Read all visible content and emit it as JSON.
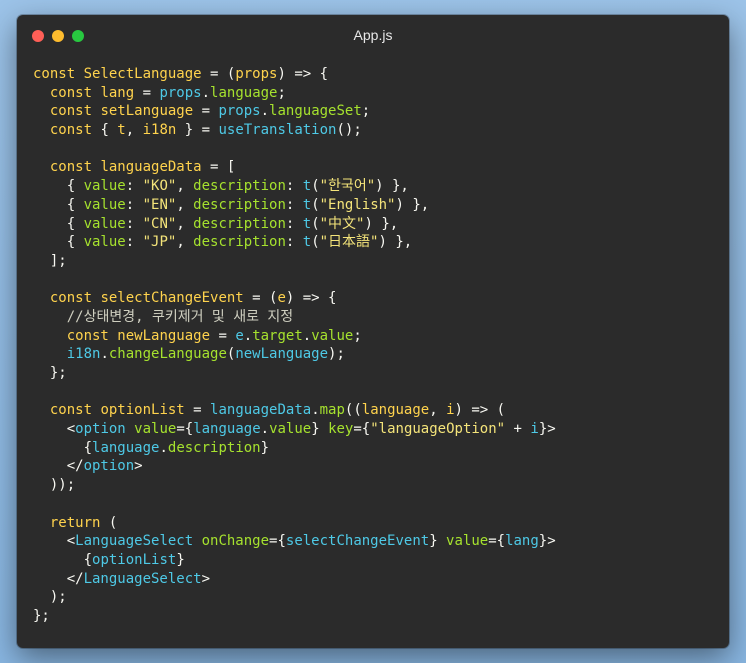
{
  "window": {
    "title": "App.js"
  },
  "colors": {
    "background": "#8fbbe3",
    "editor": "#2b2b2b",
    "keyword": "#ffd34d",
    "identifier": "#4ec9e6",
    "property": "#a6e22e",
    "string": "#f4e47a"
  },
  "code_lines": [
    [
      [
        "kw",
        "const "
      ],
      [
        "name",
        "SelectLanguage"
      ],
      [
        "op",
        " = ("
      ],
      [
        "name",
        "props"
      ],
      [
        "op",
        ") => {"
      ]
    ],
    [
      [
        "p",
        "  "
      ],
      [
        "kw",
        "const "
      ],
      [
        "name",
        "lang"
      ],
      [
        "op",
        " = "
      ],
      [
        "cyan",
        "props"
      ],
      [
        "op",
        "."
      ],
      [
        "green",
        "language"
      ],
      [
        "op",
        ";"
      ]
    ],
    [
      [
        "p",
        "  "
      ],
      [
        "kw",
        "const "
      ],
      [
        "name",
        "setLanguage"
      ],
      [
        "op",
        " = "
      ],
      [
        "cyan",
        "props"
      ],
      [
        "op",
        "."
      ],
      [
        "green",
        "languageSet"
      ],
      [
        "op",
        ";"
      ]
    ],
    [
      [
        "p",
        "  "
      ],
      [
        "kw",
        "const "
      ],
      [
        "op",
        "{ "
      ],
      [
        "name",
        "t"
      ],
      [
        "op",
        ", "
      ],
      [
        "name",
        "i18n"
      ],
      [
        "op",
        " } = "
      ],
      [
        "cyan",
        "useTranslation"
      ],
      [
        "op",
        "();"
      ]
    ],
    [],
    [
      [
        "p",
        "  "
      ],
      [
        "kw",
        "const "
      ],
      [
        "name",
        "languageData"
      ],
      [
        "op",
        " = ["
      ]
    ],
    [
      [
        "p",
        "    { "
      ],
      [
        "green",
        "value"
      ],
      [
        "op",
        ": "
      ],
      [
        "str",
        "\"KO\""
      ],
      [
        "op",
        ", "
      ],
      [
        "green",
        "description"
      ],
      [
        "op",
        ": "
      ],
      [
        "cyan",
        "t"
      ],
      [
        "op",
        "("
      ],
      [
        "str",
        "\"한국어\""
      ],
      [
        "op",
        ") },"
      ]
    ],
    [
      [
        "p",
        "    { "
      ],
      [
        "green",
        "value"
      ],
      [
        "op",
        ": "
      ],
      [
        "str",
        "\"EN\""
      ],
      [
        "op",
        ", "
      ],
      [
        "green",
        "description"
      ],
      [
        "op",
        ": "
      ],
      [
        "cyan",
        "t"
      ],
      [
        "op",
        "("
      ],
      [
        "str",
        "\"English\""
      ],
      [
        "op",
        ") },"
      ]
    ],
    [
      [
        "p",
        "    { "
      ],
      [
        "green",
        "value"
      ],
      [
        "op",
        ": "
      ],
      [
        "str",
        "\"CN\""
      ],
      [
        "op",
        ", "
      ],
      [
        "green",
        "description"
      ],
      [
        "op",
        ": "
      ],
      [
        "cyan",
        "t"
      ],
      [
        "op",
        "("
      ],
      [
        "str",
        "\"中文\""
      ],
      [
        "op",
        ") },"
      ]
    ],
    [
      [
        "p",
        "    { "
      ],
      [
        "green",
        "value"
      ],
      [
        "op",
        ": "
      ],
      [
        "str",
        "\"JP\""
      ],
      [
        "op",
        ", "
      ],
      [
        "green",
        "description"
      ],
      [
        "op",
        ": "
      ],
      [
        "cyan",
        "t"
      ],
      [
        "op",
        "("
      ],
      [
        "str",
        "\"日本語\""
      ],
      [
        "op",
        ") },"
      ]
    ],
    [
      [
        "p",
        "  ];"
      ]
    ],
    [],
    [
      [
        "p",
        "  "
      ],
      [
        "kw",
        "const "
      ],
      [
        "name",
        "selectChangeEvent"
      ],
      [
        "op",
        " = ("
      ],
      [
        "name",
        "e"
      ],
      [
        "op",
        ") => {"
      ]
    ],
    [
      [
        "p",
        "    "
      ],
      [
        "cmt",
        "//상태변경, 쿠키제거 및 새로 지정"
      ]
    ],
    [
      [
        "p",
        "    "
      ],
      [
        "kw",
        "const "
      ],
      [
        "name",
        "newLanguage"
      ],
      [
        "op",
        " = "
      ],
      [
        "cyan",
        "e"
      ],
      [
        "op",
        "."
      ],
      [
        "green",
        "target"
      ],
      [
        "op",
        "."
      ],
      [
        "green",
        "value"
      ],
      [
        "op",
        ";"
      ]
    ],
    [
      [
        "p",
        "    "
      ],
      [
        "cyan",
        "i18n"
      ],
      [
        "op",
        "."
      ],
      [
        "green",
        "changeLanguage"
      ],
      [
        "op",
        "("
      ],
      [
        "cyan",
        "newLanguage"
      ],
      [
        "op",
        ");"
      ]
    ],
    [
      [
        "p",
        "  };"
      ]
    ],
    [],
    [
      [
        "p",
        "  "
      ],
      [
        "kw",
        "const "
      ],
      [
        "name",
        "optionList"
      ],
      [
        "op",
        " = "
      ],
      [
        "cyan",
        "languageData"
      ],
      [
        "op",
        "."
      ],
      [
        "green",
        "map"
      ],
      [
        "op",
        "(("
      ],
      [
        "name",
        "language"
      ],
      [
        "op",
        ", "
      ],
      [
        "name",
        "i"
      ],
      [
        "op",
        ") => ("
      ]
    ],
    [
      [
        "p",
        "    <"
      ],
      [
        "cyan",
        "option "
      ],
      [
        "green",
        "value"
      ],
      [
        "op",
        "={"
      ],
      [
        "cyan",
        "language"
      ],
      [
        "op",
        "."
      ],
      [
        "green",
        "value"
      ],
      [
        "op",
        "} "
      ],
      [
        "green",
        "key"
      ],
      [
        "op",
        "={"
      ],
      [
        "str",
        "\"languageOption\""
      ],
      [
        "op",
        " + "
      ],
      [
        "cyan",
        "i"
      ],
      [
        "op",
        "}>"
      ]
    ],
    [
      [
        "p",
        "      {"
      ],
      [
        "cyan",
        "language"
      ],
      [
        "op",
        "."
      ],
      [
        "green",
        "description"
      ],
      [
        "op",
        "}"
      ]
    ],
    [
      [
        "p",
        "    </"
      ],
      [
        "cyan",
        "option"
      ],
      [
        "op",
        ">"
      ]
    ],
    [
      [
        "p",
        "  ));"
      ]
    ],
    [],
    [
      [
        "p",
        "  "
      ],
      [
        "kw",
        "return "
      ],
      [
        "op",
        "("
      ]
    ],
    [
      [
        "p",
        "    <"
      ],
      [
        "cyan",
        "LanguageSelect "
      ],
      [
        "green",
        "onChange"
      ],
      [
        "op",
        "={"
      ],
      [
        "cyan",
        "selectChangeEvent"
      ],
      [
        "op",
        "} "
      ],
      [
        "green",
        "value"
      ],
      [
        "op",
        "={"
      ],
      [
        "cyan",
        "lang"
      ],
      [
        "op",
        "}>"
      ]
    ],
    [
      [
        "p",
        "      {"
      ],
      [
        "cyan",
        "optionList"
      ],
      [
        "op",
        "}"
      ]
    ],
    [
      [
        "p",
        "    </"
      ],
      [
        "cyan",
        "LanguageSelect"
      ],
      [
        "op",
        ">"
      ]
    ],
    [
      [
        "p",
        "  );"
      ]
    ],
    [
      [
        "p",
        "};"
      ]
    ]
  ]
}
